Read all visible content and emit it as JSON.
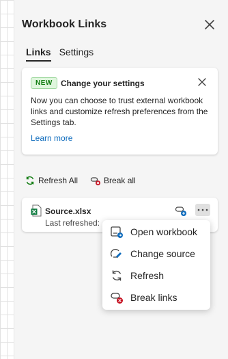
{
  "pane": {
    "title": "Workbook Links"
  },
  "tabs": [
    {
      "label": "Links",
      "active": true
    },
    {
      "label": "Settings",
      "active": false
    }
  ],
  "notice": {
    "badge": "NEW",
    "title": "Change your settings",
    "body": "Now you can choose to trust external workbook links and customize refresh preferences from the Settings tab.",
    "link": "Learn more"
  },
  "actions": {
    "refresh_all": "Refresh All",
    "break_all": "Break all"
  },
  "file": {
    "name": "Source.xlsx",
    "subtitle": "Last refreshed: J"
  },
  "menu": {
    "items": [
      {
        "label": "Open workbook",
        "icon": "open-workbook-icon"
      },
      {
        "label": "Change source",
        "icon": "change-source-icon"
      },
      {
        "label": "Refresh",
        "icon": "refresh-icon"
      },
      {
        "label": "Break links",
        "icon": "break-links-icon"
      }
    ]
  },
  "colors": {
    "accent": "#0f6cbd",
    "badge_green": "#107c10",
    "break_red": "#c50f1f",
    "refresh_green": "#107c10"
  }
}
